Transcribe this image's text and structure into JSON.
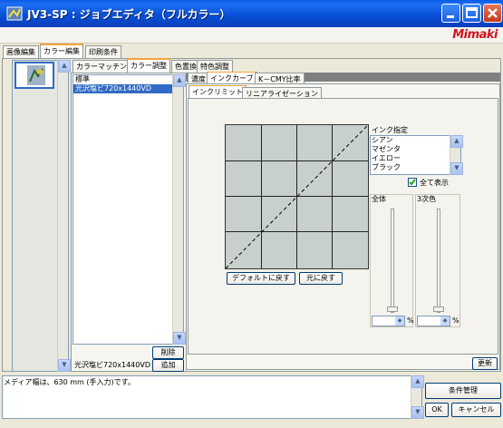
{
  "window": {
    "title": "JV3-SP : ジョブエディタ（フルカラー）",
    "brand": "Mimaki"
  },
  "main_tabs": [
    "画像編集",
    "カラー編集",
    "印刷条件"
  ],
  "color_tabs": [
    "カラーマッチング",
    "カラー調整",
    "色置換",
    "特色調整"
  ],
  "media_list": {
    "items": [
      "標準",
      "光沢塩ビ720x1440VD"
    ],
    "selected_index": 1,
    "footer_value": "光沢塩ビ720x1440VD",
    "delete_label": "削除",
    "add_label": "追加"
  },
  "adjust_tabs": [
    "濃度",
    "インクカーブ",
    "K－CMY比率"
  ],
  "curve_tabs": [
    "インクリミット",
    "リニアライゼーション"
  ],
  "ink_select": {
    "title": "インク指定",
    "items": [
      "シアン",
      "マゼンタ",
      "イエロー",
      "ブラック"
    ],
    "show_all_label": "全て表示",
    "show_all_checked": true
  },
  "sliders": [
    {
      "label": "全体",
      "unit": "%",
      "value": ""
    },
    {
      "label": "3次色",
      "unit": "%",
      "value": ""
    }
  ],
  "graph_buttons": {
    "default": "デフォルトに戻す",
    "revert": "元に戻す"
  },
  "update_label": "更新",
  "status": {
    "message": "メディア幅は、630 mm (手入力)です。"
  },
  "bottom_buttons": {
    "conditions": "条件管理",
    "ok": "OK",
    "cancel": "キャンセル"
  },
  "colors": {
    "title_blue": "#0A5CE6",
    "accent": "#F3A33D",
    "selection": "#316AC5",
    "graph_bg": "#C8D0CE"
  }
}
